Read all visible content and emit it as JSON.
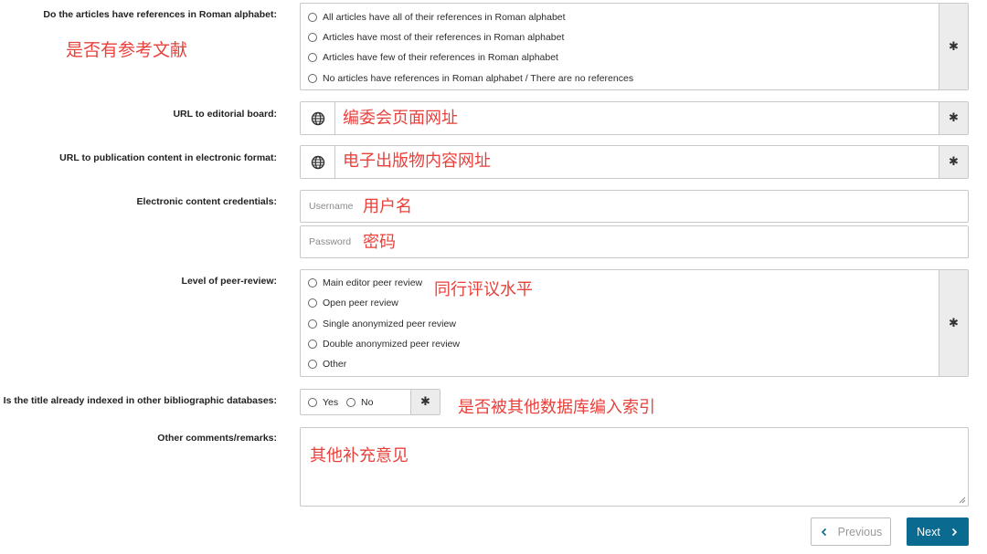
{
  "fields": {
    "roman_refs": {
      "label": "Do the articles have references in Roman alphabet:",
      "options": [
        "All articles have all of their references in Roman alphabet",
        "Articles have most of their references in Roman alphabet",
        "Articles have few of their references in Roman alphabet",
        "No articles have references in Roman alphabet / There are no references"
      ],
      "annotation": "是否有参考文献"
    },
    "editorial_url": {
      "label": "URL to editorial board:",
      "annotation": "编委会页面网址"
    },
    "publication_url": {
      "label": "URL to publication content in electronic format:",
      "annotation": "电子出版物内容网址"
    },
    "credentials": {
      "label": "Electronic content credentials:",
      "username_placeholder": "Username",
      "username_annotation": "用户名",
      "password_placeholder": "Password",
      "password_annotation": "密码"
    },
    "peer_review": {
      "label": "Level of peer-review:",
      "options": [
        "Main editor peer review",
        "Open peer review",
        "Single anonymized peer review",
        "Double anonymized peer review",
        "Other"
      ],
      "annotation": "同行评议水平"
    },
    "indexed": {
      "label": "Is the title already indexed in other bibliographic databases:",
      "options": [
        "Yes",
        "No"
      ],
      "annotation": "是否被其他数据库编入索引"
    },
    "comments": {
      "label": "Other comments/remarks:",
      "annotation": "其他补充意见"
    }
  },
  "required_marker": "✱",
  "buttons": {
    "previous": "Previous",
    "next": "Next"
  },
  "colors": {
    "annotation": "#e8413c",
    "next_button": "#0b6a8f",
    "field_side": "#ececec"
  },
  "icons": {
    "url_fields": "globe-icon",
    "previous": "chevron-left-icon",
    "next": "chevron-right-icon"
  }
}
